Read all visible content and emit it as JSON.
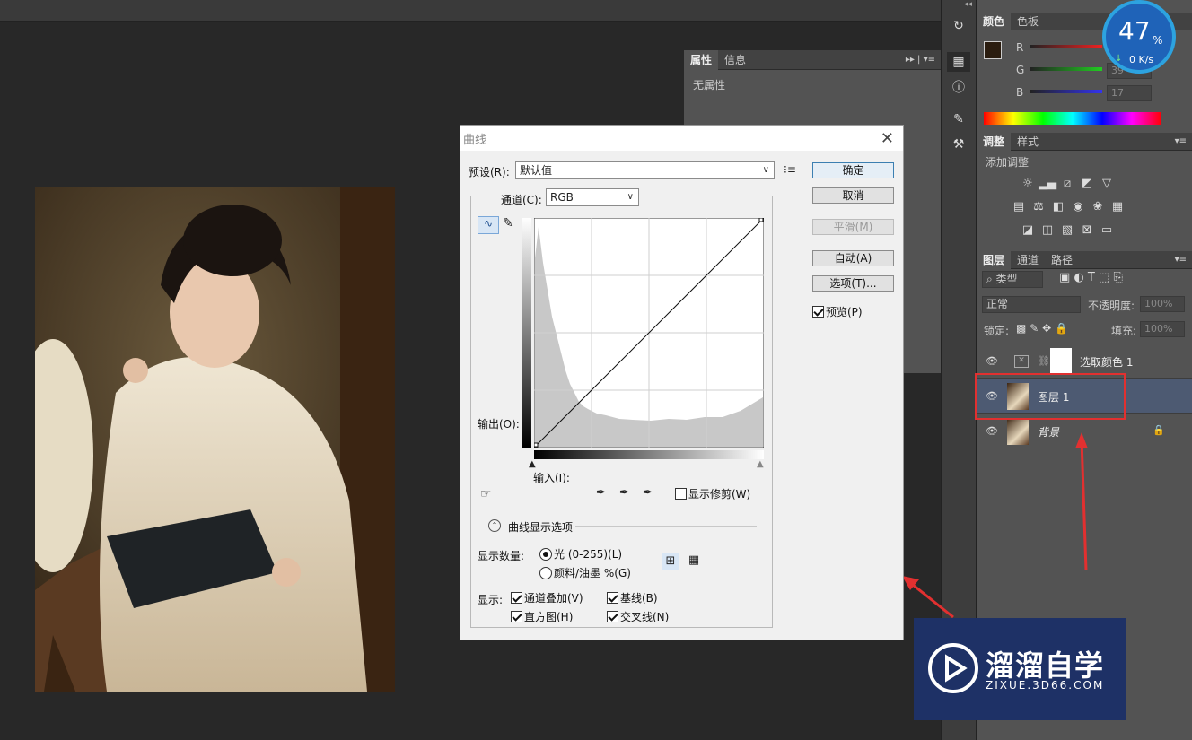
{
  "properties_panel": {
    "tabs": [
      "属性",
      "信息"
    ],
    "content": "无属性"
  },
  "curves_dialog": {
    "title": "曲线",
    "preset_label": "预设(R):",
    "preset_value": "默认值",
    "channel_label": "通道(C):",
    "channel_value": "RGB",
    "output_label": "输出(O):",
    "input_label": "输入(I):",
    "show_clipping_label": "显示修剪(W)",
    "display_options_label": "曲线显示选项",
    "show_amount_label": "显示数量:",
    "light_option": "光 (0-255)(L)",
    "pigment_option": "颜料/油墨 %(G)",
    "show_label": "显示:",
    "channel_overlay": "通道叠加(V)",
    "baseline": "基线(B)",
    "histogram": "直方图(H)",
    "intersection": "交叉线(N)",
    "buttons": {
      "ok": "确定",
      "cancel": "取消",
      "smooth": "平滑(M)",
      "auto": "自动(A)",
      "options": "选项(T)..."
    },
    "preview_label": "预览(P)"
  },
  "color_panel": {
    "tabs": [
      "颜色",
      "色板"
    ],
    "r_label": "R",
    "g_label": "G",
    "b_label": "B",
    "g_value": "39",
    "b_value": "17",
    "foreground": "#2a1c0f",
    "background": "#000000"
  },
  "speed_widget": {
    "percent": "47",
    "percent_sign": "%",
    "rate": "0 K/s"
  },
  "adjustments_panel": {
    "tabs": [
      "调整",
      "样式"
    ],
    "add_label": "添加调整"
  },
  "layers_panel": {
    "tabs": [
      "图层",
      "通道",
      "路径"
    ],
    "filter_label": "类型",
    "blend_mode": "正常",
    "opacity_label": "不透明度:",
    "opacity_value": "100%",
    "lock_label": "锁定:",
    "fill_label": "填充:",
    "fill_value": "100%",
    "layers": [
      {
        "name": "选取颜色 1"
      },
      {
        "name": "图层 1"
      },
      {
        "name": "背景"
      }
    ]
  },
  "watermark": {
    "brand": "溜溜自学",
    "url": "ZIXUE.3D66.COM"
  }
}
